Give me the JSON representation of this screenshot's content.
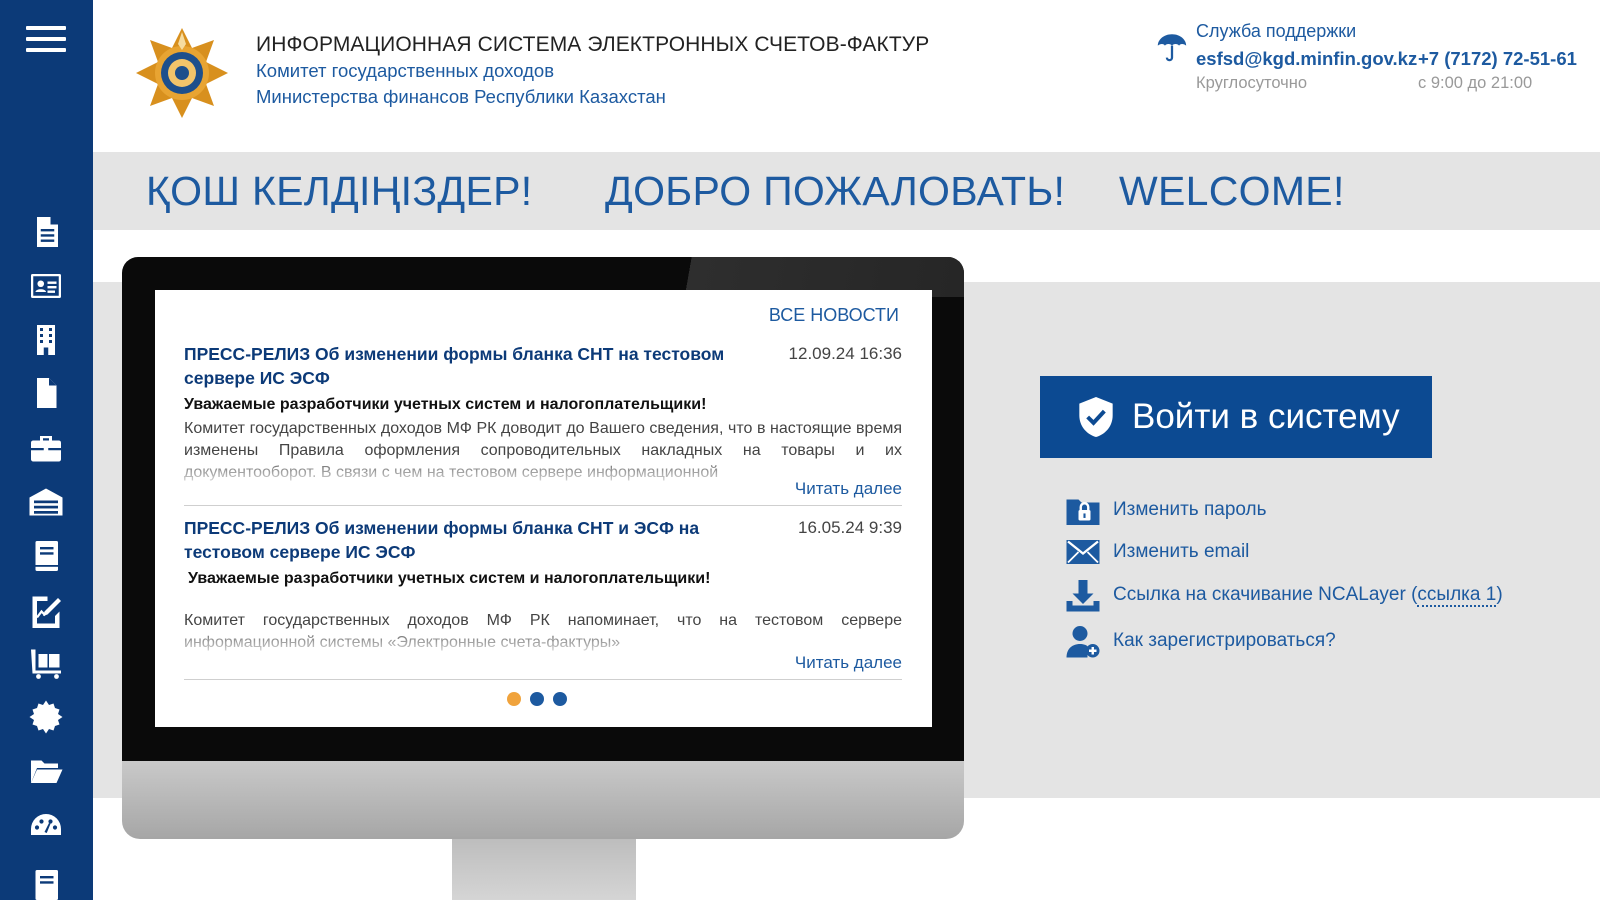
{
  "header": {
    "title": "ИНФОРМАЦИОННАЯ СИСТЕМА ЭЛЕКТРОННЫХ СЧЕТОВ-ФАКТУР",
    "subtitle1": "Комитет государственных доходов",
    "subtitle2": "Министерства финансов Республики Казахстан"
  },
  "support": {
    "title": "Служба поддержки",
    "email": "esfsd@kgd.minfin.gov.kz",
    "phone": "+7 (7172) 72-51-61",
    "hours_email": "Круглосуточно",
    "hours_phone": "с 9:00 до 21:00"
  },
  "welcome": {
    "kz": "ҚОШ КЕЛДІҢІЗДЕР!",
    "ru": "ДОБРО ПОЖАЛОВАТЬ!",
    "en": "WELCOME!"
  },
  "news": {
    "all_news_label": "ВСЕ НОВОСТИ",
    "read_more": "Читать далее",
    "items": [
      {
        "title": "ПРЕСС-РЕЛИЗ Об изменении формы бланка СНТ на тестовом сервере ИС ЭСФ",
        "date": "12.09.24 16:36",
        "lead": "Уважаемые разработчики учетных систем и налогоплательщики!",
        "body": "Комитет государственных доходов МФ РК доводит до Вашего сведения, что в настоящие время изменены Правила оформления сопроводительных накладных на товары и их документооборот. В связи с чем на тестовом сервере информационной"
      },
      {
        "title": "ПРЕСС-РЕЛИЗ Об изменении формы бланка СНТ и ЭСФ на тестовом сервере ИС ЭСФ",
        "date": "16.05.24 9:39",
        "lead": "Уважаемые разработчики учетных систем и налогоплательщики!",
        "body": "Комитет государственных доходов МФ РК напоминает, что на тестовом сервере информационной системы «Электронные счета-фактуры»"
      }
    ],
    "dot_colors": [
      "#f0a33c",
      "#1d5aa0",
      "#1d5aa0"
    ]
  },
  "login": {
    "button_label": "Войти в систему",
    "change_password": "Изменить пароль",
    "change_email": "Изменить email",
    "ncalayer_prefix": "Ссылка на скачивание NCALayer (",
    "ncalayer_link": "ссылка 1",
    "ncalayer_suffix": ")",
    "how_to_register": "Как зарегистрироваться?"
  },
  "sidebar": {
    "icons": [
      "document-icon",
      "id-card-icon",
      "building-icon",
      "file-icon",
      "briefcase-icon",
      "warehouse-icon",
      "book-icon",
      "signature-icon",
      "cart-icon",
      "gear-icon",
      "folder-icon",
      "dashboard-icon",
      "list-icon"
    ]
  },
  "colors": {
    "primary": "#0c3a78",
    "accent": "#1d5aa0",
    "dot_active": "#f0a33c"
  }
}
